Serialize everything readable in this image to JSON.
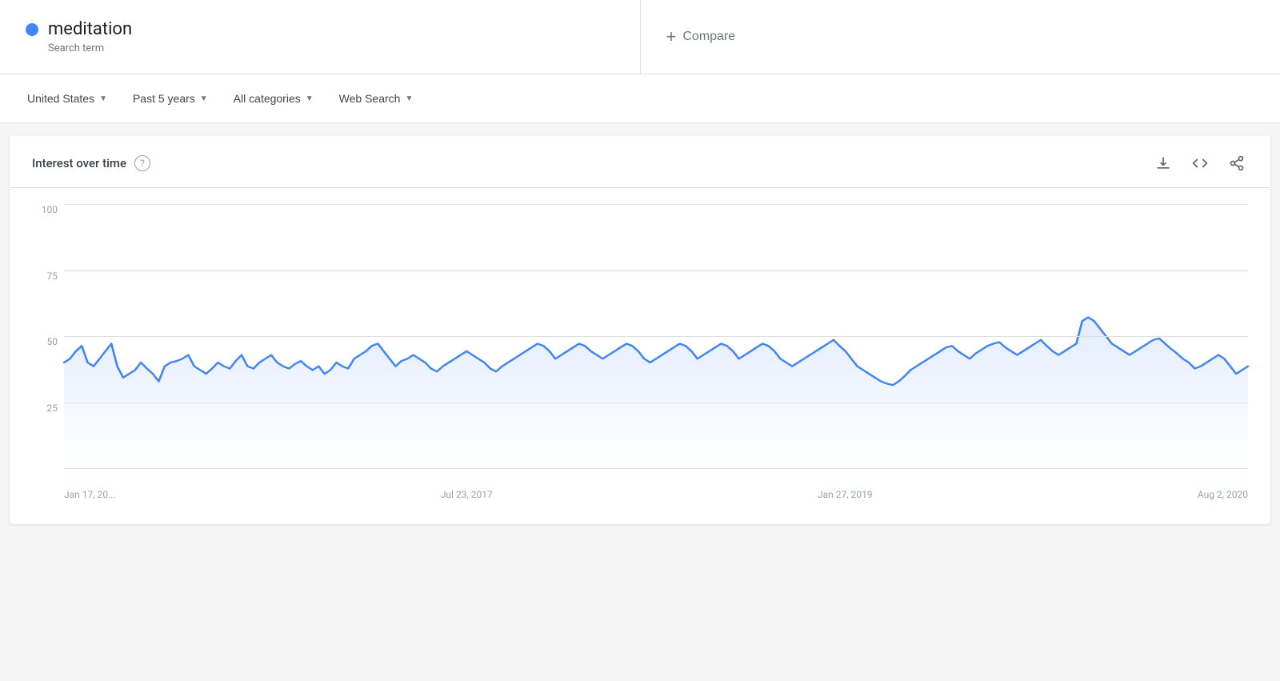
{
  "header": {
    "search_term": "meditation",
    "search_term_label": "Search term",
    "compare_label": "Compare"
  },
  "filters": {
    "location": "United States",
    "time_range": "Past 5 years",
    "categories": "All categories",
    "search_type": "Web Search"
  },
  "chart": {
    "title": "Interest over time",
    "help_tooltip": "?",
    "y_labels": [
      "100",
      "75",
      "50",
      "25"
    ],
    "x_labels": [
      "Jan 17, 20...",
      "Jul 23, 2017",
      "Jan 27, 2019",
      "Aug 2, 2020"
    ],
    "download_label": "Download",
    "embed_label": "Embed",
    "share_label": "Share"
  }
}
